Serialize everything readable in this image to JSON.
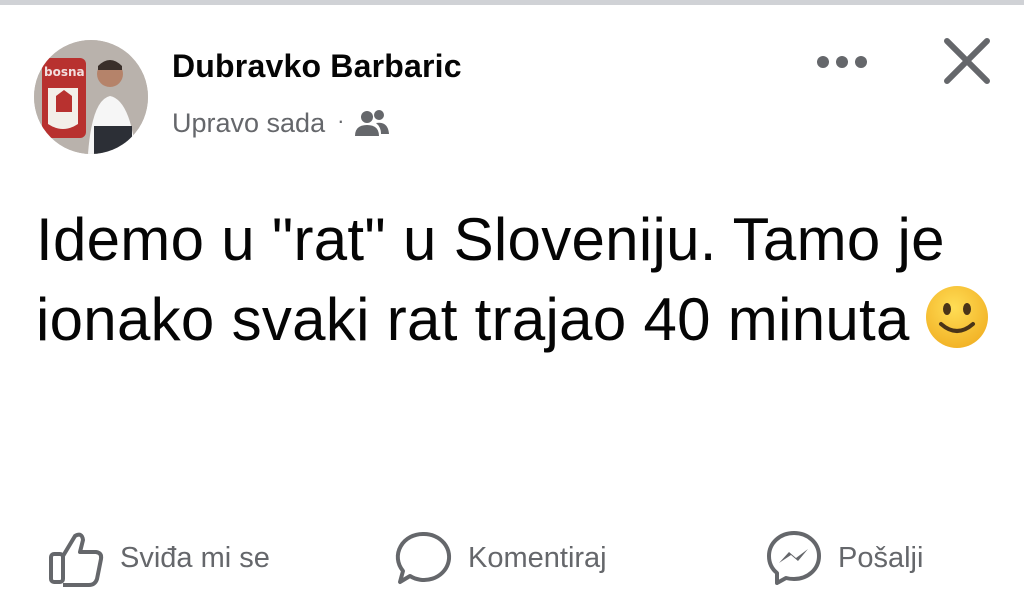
{
  "post": {
    "author": {
      "name": "Dubravko Barbaric",
      "avatar_logo_text": "bosna"
    },
    "timestamp": "Upravo sada",
    "separator": "·",
    "audience_icon": "friends-icon",
    "text": "Idemo u \"rat\" u Sloveniju. Tamo je ionako svaki rat trajao 40 minuta",
    "emoji": "slightly-smiling-face-icon"
  },
  "header_actions": {
    "more_icon": "more-horizontal-icon",
    "close_icon": "close-icon"
  },
  "actions": {
    "like": {
      "label": "Sviđa mi se",
      "icon": "thumbs-up-icon"
    },
    "comment": {
      "label": "Komentiraj",
      "icon": "comment-bubble-icon"
    },
    "send": {
      "label": "Pošalji",
      "icon": "messenger-icon"
    }
  },
  "colors": {
    "text_primary": "#050505",
    "text_secondary": "#65676b",
    "background": "#ffffff",
    "emoji_yellow": "#f7c33a",
    "top_strip": "#d0d2d6"
  }
}
